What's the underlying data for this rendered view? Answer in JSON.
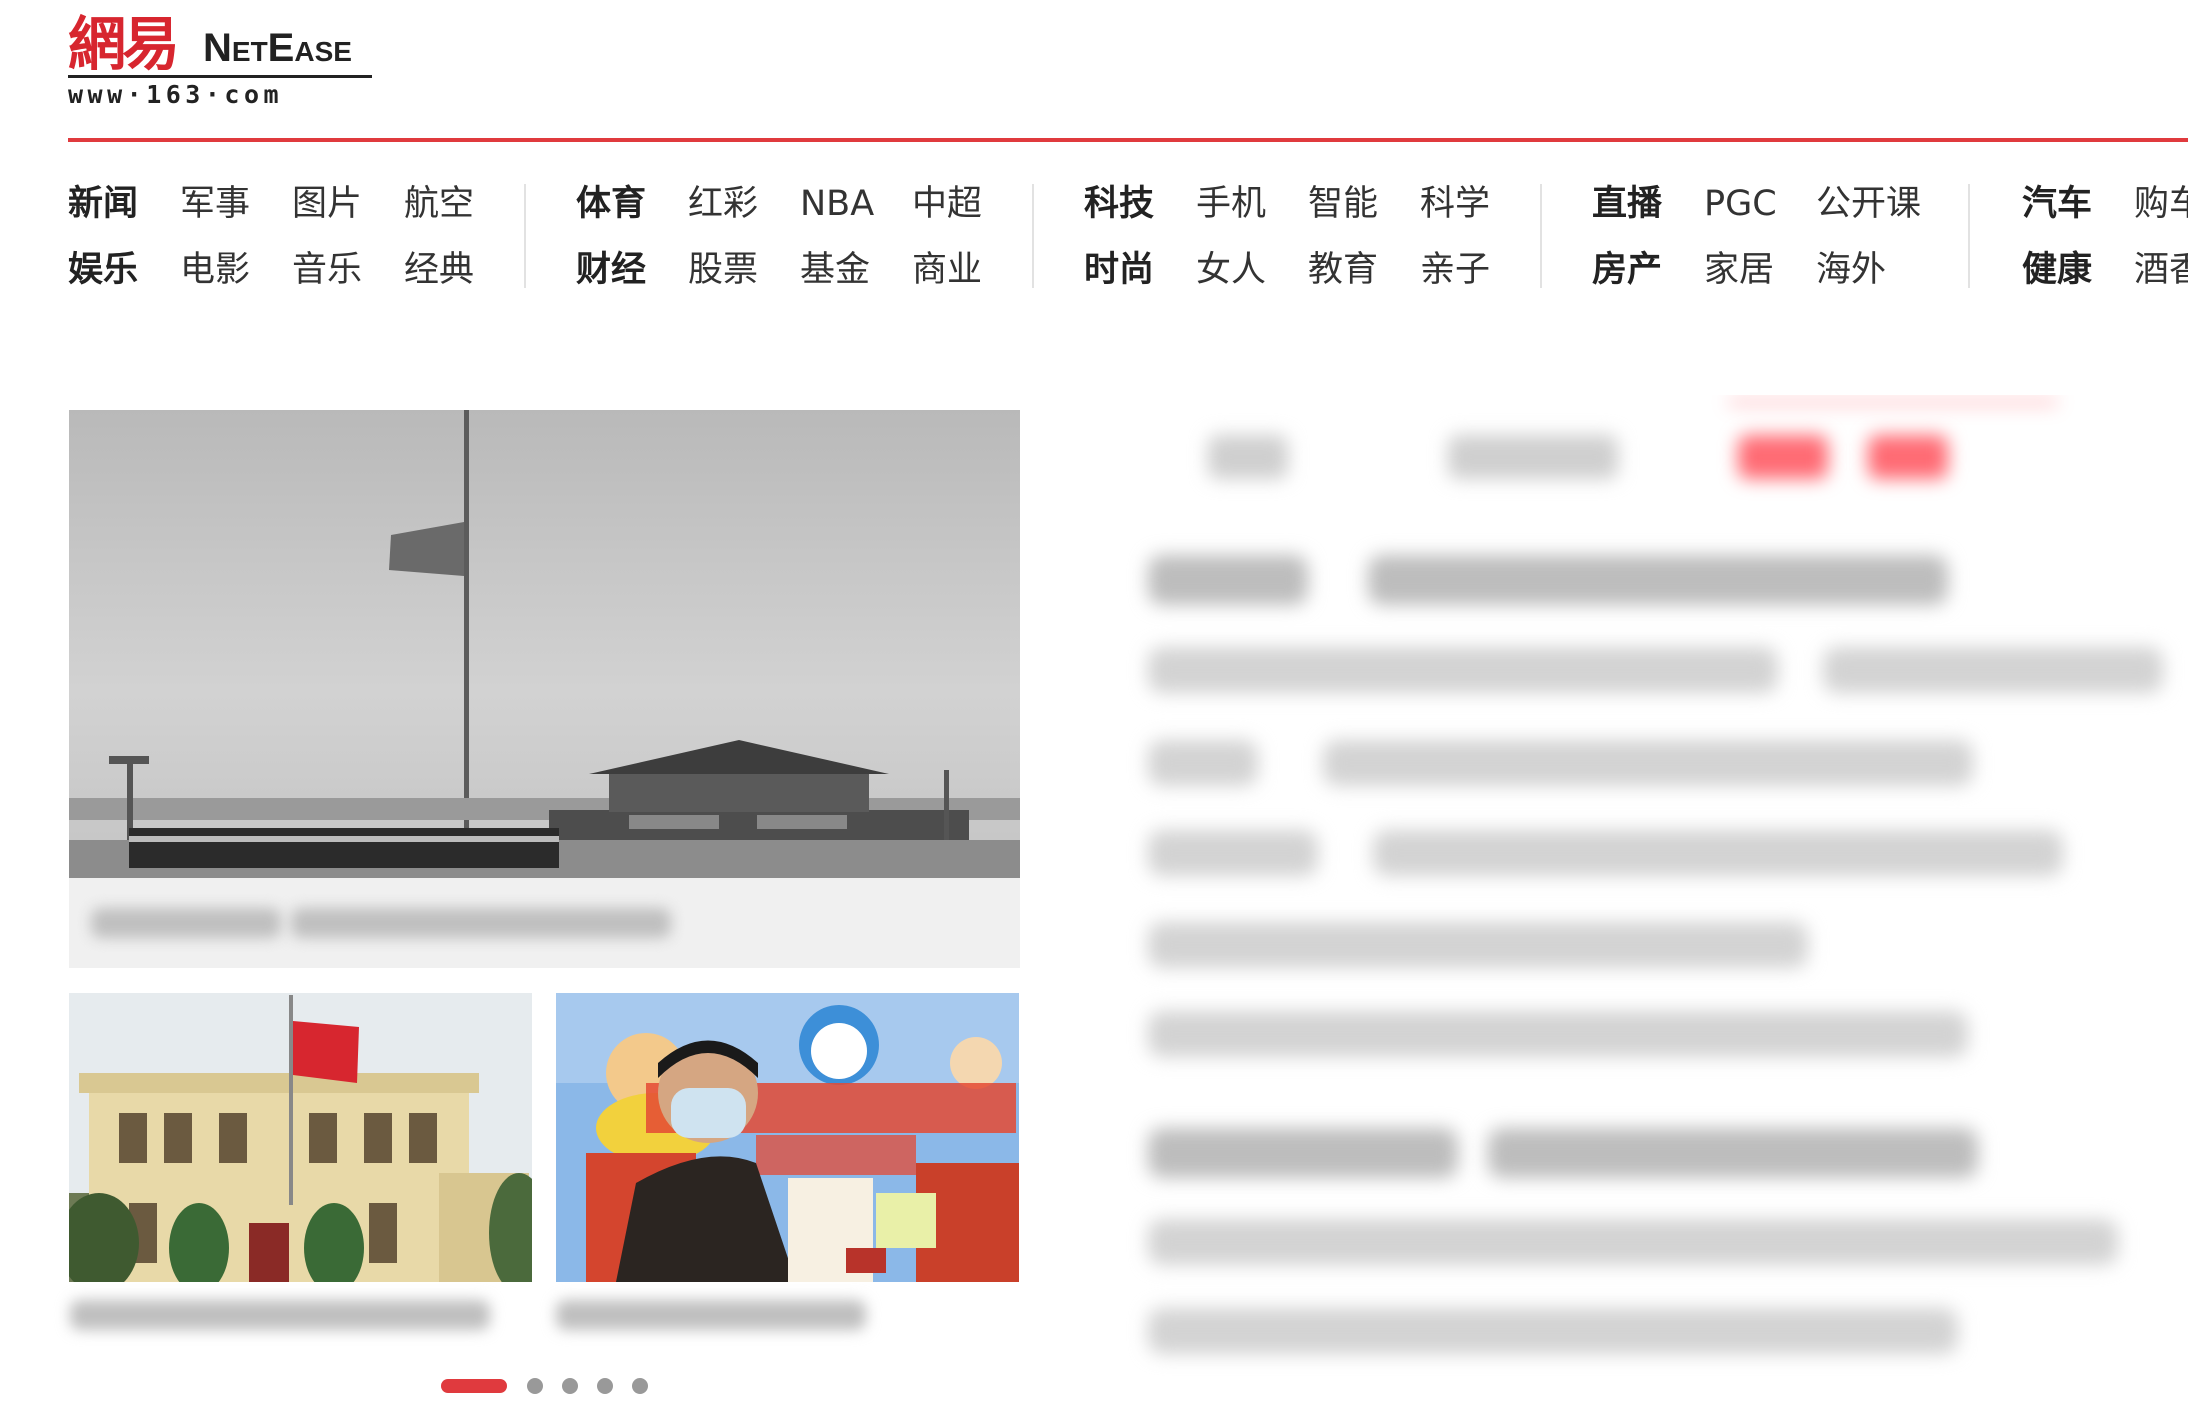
{
  "header": {
    "logo_cn": "網易",
    "logo_en": "NetEase",
    "logo_url": "www·163·com"
  },
  "nav": {
    "groups": [
      {
        "row1": [
          "新闻",
          "军事",
          "图片",
          "航空"
        ],
        "row2": [
          "娱乐",
          "电影",
          "音乐",
          "经典"
        ]
      },
      {
        "row1": [
          "体育",
          "红彩",
          "NBA",
          "中超"
        ],
        "row2": [
          "财经",
          "股票",
          "基金",
          "商业"
        ]
      },
      {
        "row1": [
          "科技",
          "手机",
          "智能",
          "科学"
        ],
        "row2": [
          "时尚",
          "女人",
          "教育",
          "亲子"
        ]
      },
      {
        "row1": [
          "直播",
          "PGC",
          "公开课"
        ],
        "row2": [
          "房产",
          "家居",
          "海外"
        ]
      },
      {
        "row1": [
          "汽车",
          "购车"
        ],
        "row2": [
          "健康",
          "酒香"
        ]
      }
    ]
  },
  "carousel": {
    "total_slides": 5,
    "active_index": 0
  },
  "colors": {
    "brand_red": "#e03a3e",
    "nav_text": "#333333"
  }
}
